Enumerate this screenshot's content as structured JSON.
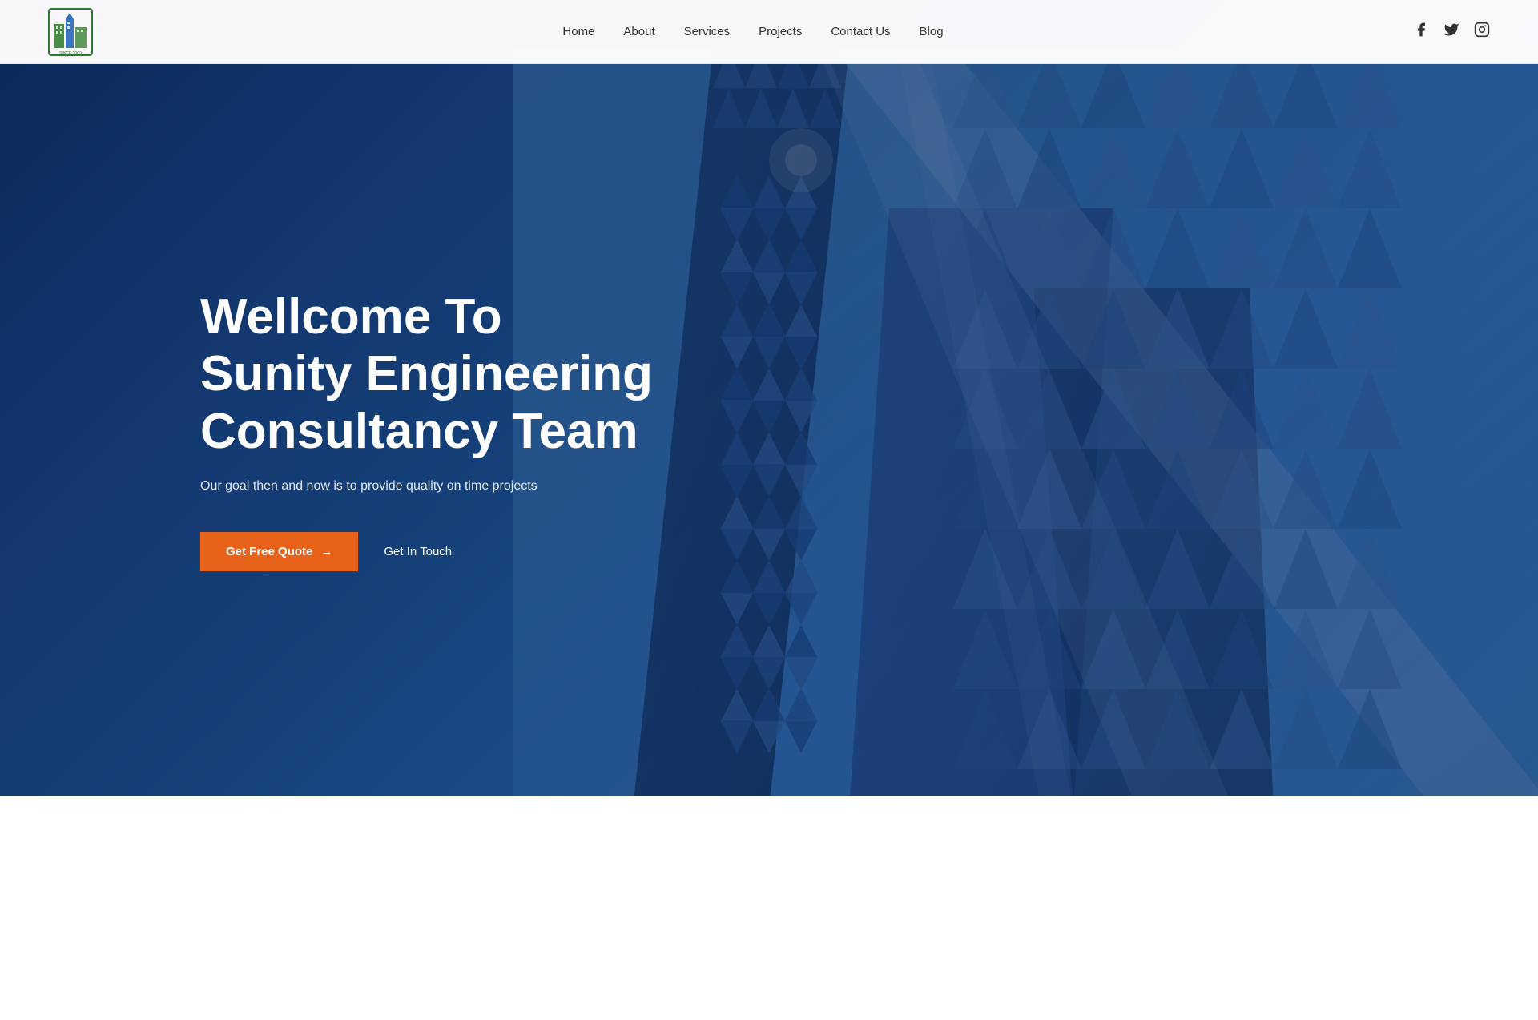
{
  "navbar": {
    "logo_alt": "Sunity Engineering Logo",
    "links": [
      {
        "label": "Home",
        "id": "home"
      },
      {
        "label": "About",
        "id": "about"
      },
      {
        "label": "Services",
        "id": "services"
      },
      {
        "label": "Projects",
        "id": "projects"
      },
      {
        "label": "Contact Us",
        "id": "contact"
      },
      {
        "label": "Blog",
        "id": "blog"
      }
    ],
    "social": [
      {
        "name": "facebook",
        "label": "Facebook"
      },
      {
        "name": "twitter",
        "label": "Twitter"
      },
      {
        "name": "instagram",
        "label": "Instagram"
      }
    ]
  },
  "hero": {
    "title_line1": "Wellcome To",
    "title_line2": "Sunity Engineering",
    "title_line3": "Consultancy Team",
    "subtitle": "Our goal then and now is to provide quality on time projects",
    "btn_quote": "Get Free Quote",
    "btn_arrow": "→",
    "btn_touch": "Get In Touch"
  }
}
